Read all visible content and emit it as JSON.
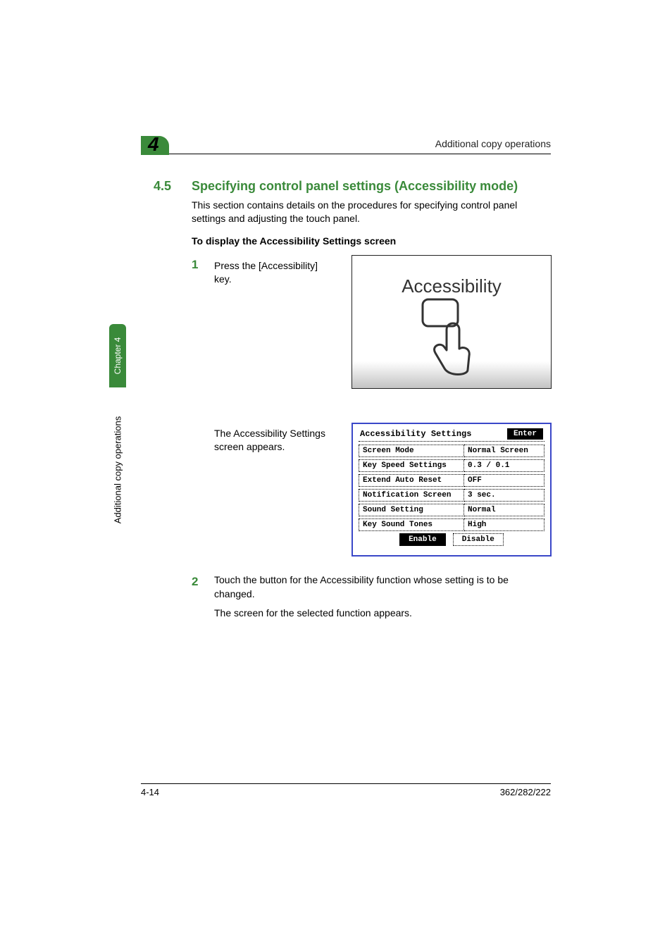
{
  "header": "Additional copy operations",
  "chapter_number": "4",
  "section_number": "4.5",
  "section_title": "Specifying control panel settings (Accessibility mode)",
  "intro": "This section contains details on the procedures for specifying control panel settings and adjusting the touch panel.",
  "subheading": "To display the Accessibility Settings screen",
  "steps": {
    "one_num": "1",
    "one_text": "Press the [Accessibility] key.",
    "one_result": "The Accessibility Settings screen appears.",
    "two_num": "2",
    "two_text": "Touch the button for the Accessibility function whose setting is to be changed.",
    "two_result": "The screen for the selected function appears."
  },
  "illustration_label": "Accessibility",
  "lcd": {
    "title": "Accessibility Settings",
    "enter": "Enter",
    "rows": [
      {
        "label": "Screen Mode",
        "value": "Normal Screen"
      },
      {
        "label": "Key Speed Settings",
        "value": "0.3 / 0.1"
      },
      {
        "label": "Extend Auto Reset",
        "value": "OFF"
      },
      {
        "label": "Notification Screen",
        "value": "3 sec."
      },
      {
        "label": "Sound Setting",
        "value": "Normal"
      },
      {
        "label": "Key Sound Tones",
        "value": "High"
      }
    ],
    "enable": "Enable",
    "disable": "Disable"
  },
  "side_tab": "Chapter 4",
  "side_label": "Additional copy operations",
  "footer_left": "4-14",
  "footer_right": "362/282/222"
}
